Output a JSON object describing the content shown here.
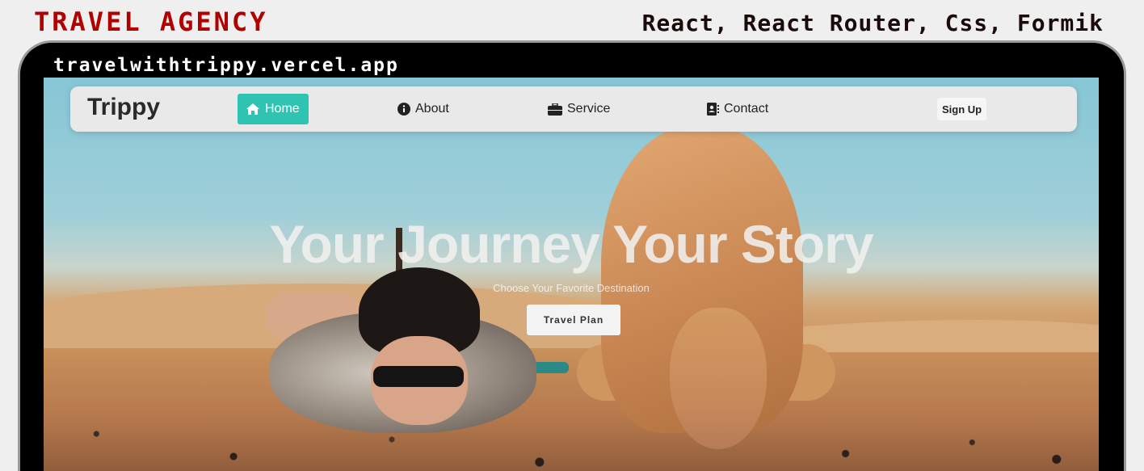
{
  "header": {
    "left_title": "TRAVEL AGENCY",
    "right_title": "React, React Router, Css, Formik"
  },
  "browser": {
    "url": "travelwithtrippy.vercel.app"
  },
  "navbar": {
    "brand": "Trippy",
    "items": [
      {
        "label": "Home",
        "icon": "house-icon",
        "active": true
      },
      {
        "label": "About",
        "icon": "info-circle-icon",
        "active": false
      },
      {
        "label": "Service",
        "icon": "briefcase-icon",
        "active": false
      },
      {
        "label": "Contact",
        "icon": "address-book-icon",
        "active": false
      }
    ],
    "signup_label": "Sign Up"
  },
  "hero": {
    "title": "Your Journey Your Story",
    "subtitle": "Choose Your Favorite Destination",
    "button_label": "Travel Plan"
  },
  "colors": {
    "accent": "#2fc4b2",
    "title_red": "#b00000"
  }
}
